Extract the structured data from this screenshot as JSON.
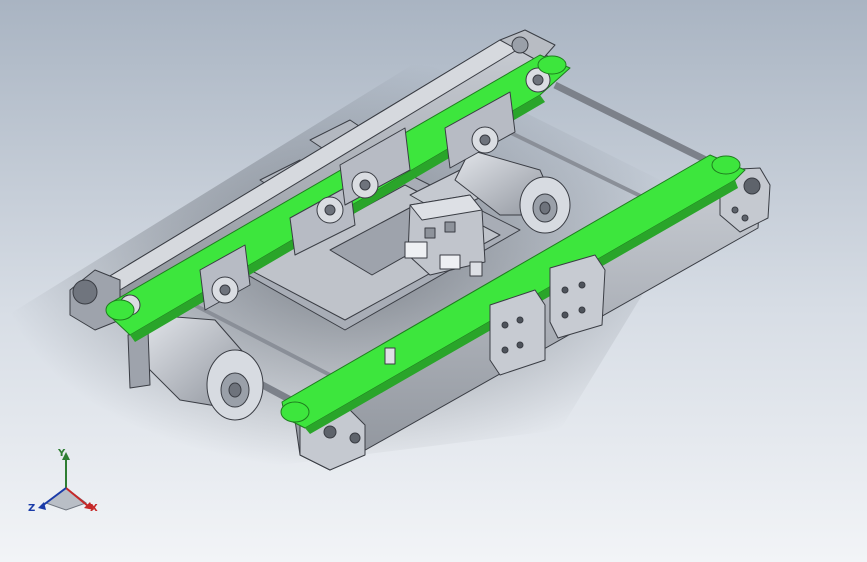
{
  "viewport": {
    "background_top": "#a9b4c2",
    "background_bottom": "#f2f4f7"
  },
  "model": {
    "belt_color": "#3de63d",
    "frame_color": "#b7bbc4",
    "motor_color": "#c9cdd4"
  },
  "triad": {
    "x_label": "X",
    "y_label": "Y",
    "z_label": "Z",
    "x_color": "#c62828",
    "y_color": "#2e7d32",
    "z_color": "#1a3ba8"
  }
}
